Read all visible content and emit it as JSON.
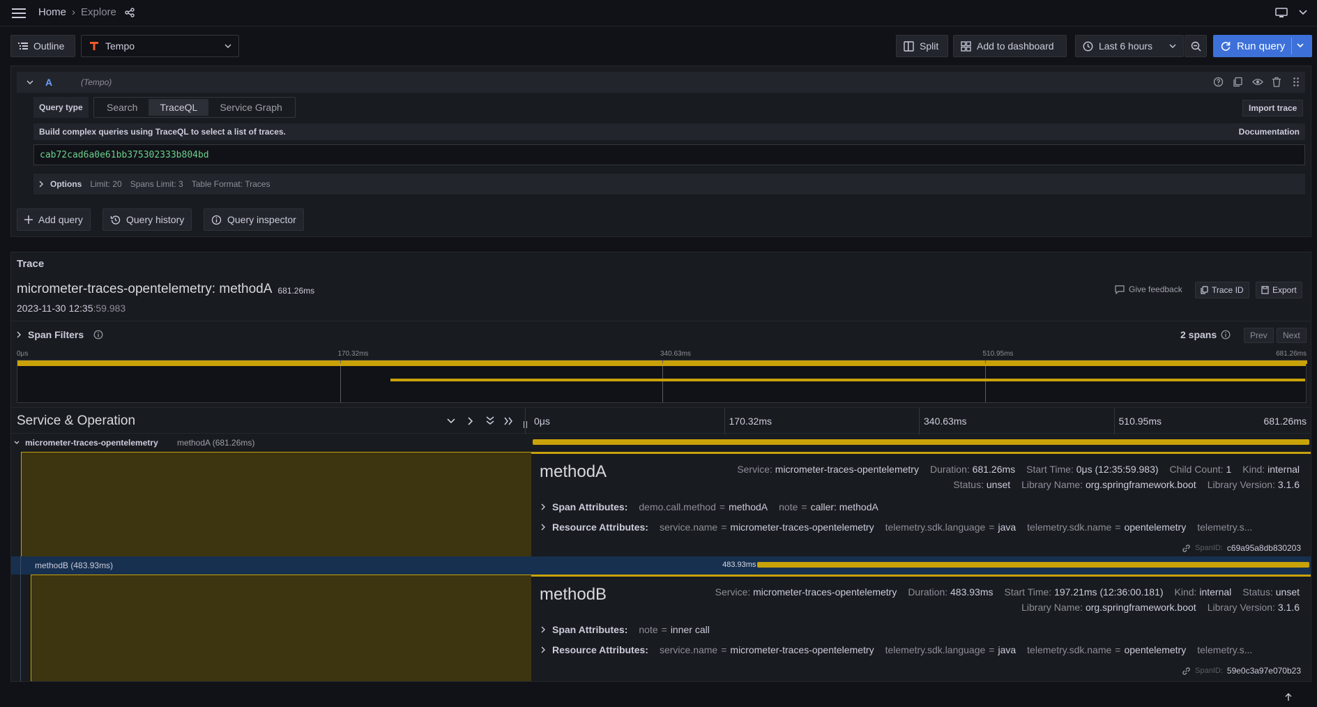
{
  "topbar": {
    "breadcrumb_home": "Home",
    "breadcrumb_sep": "›",
    "breadcrumb_current": "Explore"
  },
  "toolbar": {
    "outline": "Outline",
    "datasource": "Tempo",
    "split": "Split",
    "add_to_dashboard": "Add to dashboard",
    "time_range": "Last 6 hours",
    "run_query": "Run query"
  },
  "query": {
    "ref_id": "A",
    "datasource_hint": "(Tempo)",
    "query_type_label": "Query type",
    "tabs": [
      "Search",
      "TraceQL",
      "Service Graph"
    ],
    "active_tab": "TraceQL",
    "import_trace": "Import trace",
    "help_text": "Build complex queries using TraceQL to select a list of traces.",
    "documentation": "Documentation",
    "query_value": "cab72cad6a0e61bb375302333b804bd",
    "options_label": "Options",
    "options": [
      "Limit: 20",
      "Spans Limit: 3",
      "Table Format: Traces"
    ]
  },
  "actions": {
    "add_query": "Add query",
    "query_history": "Query history",
    "query_inspector": "Query inspector"
  },
  "trace": {
    "panel_title": "Trace",
    "title": "micrometer-traces-opentelemetry: methodA",
    "duration": "681.26ms",
    "date": "2023-11-30 12:35",
    "date_seconds": ":59.983",
    "give_feedback": "Give feedback",
    "trace_id_btn": "Trace ID",
    "export_btn": "Export",
    "span_filters": "Span Filters",
    "span_count": "2 spans",
    "prev": "Prev",
    "next": "Next",
    "minimap_ticks": [
      "0μs",
      "170.32ms",
      "340.63ms",
      "510.95ms",
      "681.26ms"
    ],
    "header_title": "Service & Operation",
    "timeline_ticks": [
      "0μs",
      "170.32ms",
      "340.63ms",
      "510.95ms",
      "681.26ms"
    ]
  },
  "spans": [
    {
      "service": "micrometer-traces-opentelemetry",
      "op_label": "methodA (681.26ms)",
      "name": "methodA",
      "start_fraction": 0.0,
      "width_fraction": 1.0,
      "bar_label": "",
      "meta_line1": [
        {
          "k": "Service:",
          "v": "micrometer-traces-opentelemetry"
        },
        {
          "k": "Duration:",
          "v": "681.26ms"
        },
        {
          "k": "Start Time:",
          "v": "0μs (12:35:59.983)"
        },
        {
          "k": "Child Count:",
          "v": "1"
        },
        {
          "k": "Kind:",
          "v": "internal"
        }
      ],
      "meta_line2": [
        {
          "k": "Status:",
          "v": "unset"
        },
        {
          "k": "Library Name:",
          "v": "org.springframework.boot"
        },
        {
          "k": "Library Version:",
          "v": "3.1.6"
        }
      ],
      "span_attrs_label": "Span Attributes:",
      "span_attrs": [
        {
          "k": "demo.call.method",
          "v": "methodA"
        },
        {
          "k": "note",
          "v": "caller: methodA"
        }
      ],
      "resource_attrs_label": "Resource Attributes:",
      "resource_attrs": [
        {
          "k": "service.name",
          "v": "micrometer-traces-opentelemetry"
        },
        {
          "k": "telemetry.sdk.language",
          "v": "java"
        },
        {
          "k": "telemetry.sdk.name",
          "v": "opentelemetry"
        }
      ],
      "resource_more": "telemetry.s...",
      "span_id_label": "SpanID:",
      "span_id": "c69a95a8db830203"
    },
    {
      "service": "",
      "op_label": "methodB (483.93ms)",
      "name": "methodB",
      "start_fraction": 0.2894,
      "width_fraction": 0.7103,
      "bar_label": "483.93ms",
      "meta_line1": [
        {
          "k": "Service:",
          "v": "micrometer-traces-opentelemetry"
        },
        {
          "k": "Duration:",
          "v": "483.93ms"
        },
        {
          "k": "Start Time:",
          "v": "197.21ms (12:36:00.181)"
        },
        {
          "k": "Kind:",
          "v": "internal"
        },
        {
          "k": "Status:",
          "v": "unset"
        }
      ],
      "meta_line2": [
        {
          "k": "Library Name:",
          "v": "org.springframework.boot"
        },
        {
          "k": "Library Version:",
          "v": "3.1.6"
        }
      ],
      "span_attrs_label": "Span Attributes:",
      "span_attrs": [
        {
          "k": "note",
          "v": "inner call"
        }
      ],
      "resource_attrs_label": "Resource Attributes:",
      "resource_attrs": [
        {
          "k": "service.name",
          "v": "micrometer-traces-opentelemetry"
        },
        {
          "k": "telemetry.sdk.language",
          "v": "java"
        },
        {
          "k": "telemetry.sdk.name",
          "v": "opentelemetry"
        }
      ],
      "resource_more": "telemetry.s...",
      "span_id_label": "SpanID:",
      "span_id": "59e0c3a97e070b23"
    }
  ],
  "colors": {
    "accent_blue": "#3d71d9",
    "span_yellow": "#c9a20a",
    "query_green": "#6ccf8e",
    "selected_row": "#17304f"
  }
}
